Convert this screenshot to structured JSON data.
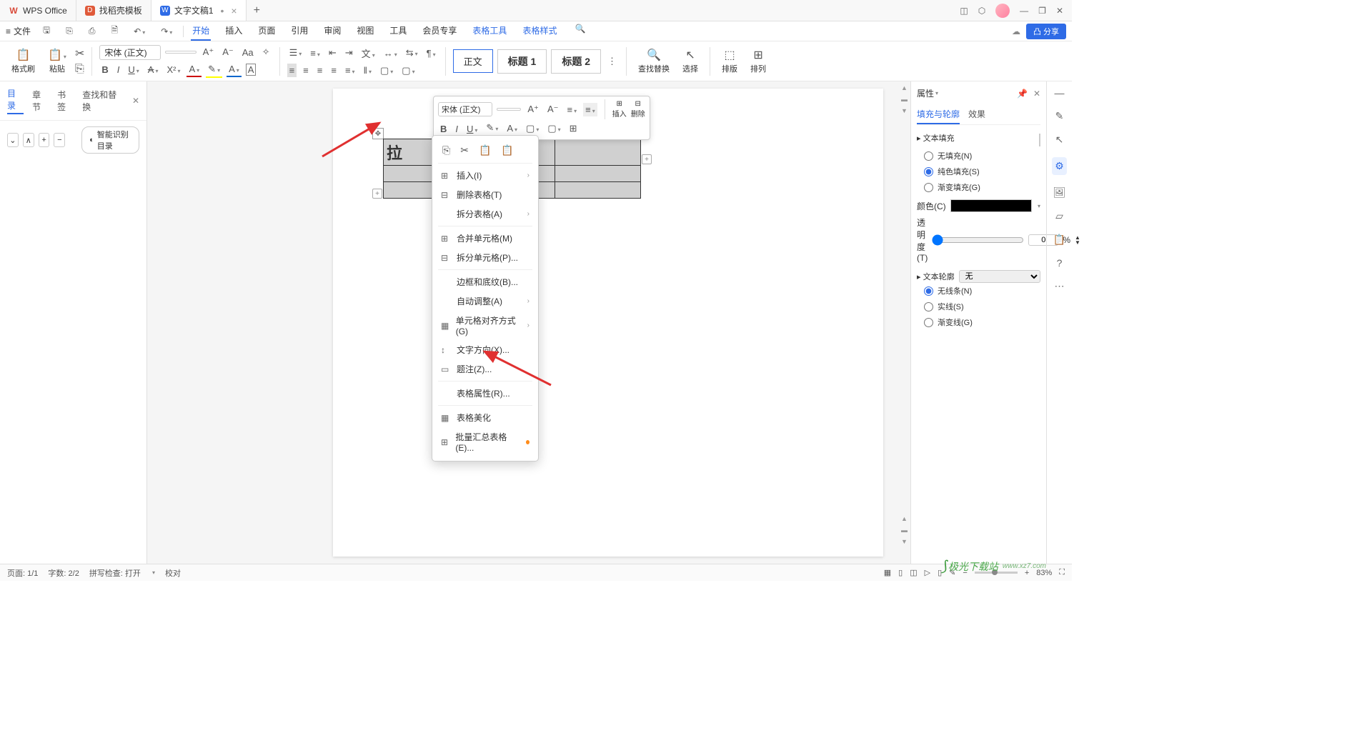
{
  "titlebar": {
    "app": "WPS Office",
    "tab_template": "找稻壳模板",
    "tab_doc": "文字文稿1",
    "min": "—",
    "max": "❐",
    "close": "✕"
  },
  "menubar": {
    "file": "文件",
    "items": [
      "开始",
      "插入",
      "页面",
      "引用",
      "审阅",
      "视图",
      "工具",
      "会员专享",
      "表格工具",
      "表格样式"
    ],
    "active_index": 0,
    "share": "分享"
  },
  "ribbon": {
    "format_painter": "格式刷",
    "paste": "粘贴",
    "font": "宋体 (正文)",
    "find_replace": "查找替换",
    "select": "选择",
    "arrange": "排版",
    "sort": "排列",
    "style_normal": "正文",
    "style_h1": "标题 1",
    "style_h2": "标题 2"
  },
  "leftpanel": {
    "tabs": [
      "目录",
      "章节",
      "书签",
      "查找和替换"
    ],
    "smart": "智能识别目录"
  },
  "float_toolbar": {
    "font": "宋体 (正文)",
    "insert": "插入",
    "delete": "删除"
  },
  "table_cell": "拉",
  "context": {
    "items": [
      {
        "icon": "⊞",
        "label": "插入(I)",
        "arrow": true
      },
      {
        "icon": "⊟",
        "label": "删除表格(T)"
      },
      {
        "icon": "",
        "label": "拆分表格(A)",
        "arrow": true
      },
      {
        "icon": "⊞",
        "label": "合并单元格(M)"
      },
      {
        "icon": "⊟",
        "label": "拆分单元格(P)..."
      },
      {
        "icon": "",
        "label": "边框和底纹(B)..."
      },
      {
        "icon": "",
        "label": "自动调整(A)",
        "arrow": true
      },
      {
        "icon": "▦",
        "label": "单元格对齐方式(G)",
        "arrow": true
      },
      {
        "icon": "↕",
        "label": "文字方向(X)..."
      },
      {
        "icon": "▭",
        "label": "题注(Z)..."
      },
      {
        "icon": "",
        "label": "表格属性(R)..."
      },
      {
        "icon": "▦",
        "label": "表格美化"
      },
      {
        "icon": "⊞",
        "label": "批量汇总表格(E)...",
        "dot": true
      }
    ]
  },
  "rightpanel": {
    "title": "属性",
    "tabs": [
      "填充与轮廓",
      "效果"
    ],
    "text_fill": "文本填充",
    "fill_none": "无填充(N)",
    "fill_solid": "纯色填充(S)",
    "fill_grad": "渐变填充(G)",
    "color": "颜色(C)",
    "opacity": "透明度(T)",
    "opacity_val": "0",
    "pct": "%",
    "text_outline": "文本轮廓",
    "outline_sel": "无",
    "line_none": "无线条(N)",
    "line_solid": "实线(S)",
    "line_grad": "渐变线(G)"
  },
  "statusbar": {
    "page": "页面: 1/1",
    "words": "字数: 2/2",
    "spell": "拼写检查: 打开",
    "proof": "校对",
    "zoom": "83%"
  },
  "watermark": {
    "brand": "极光下载站",
    "url": "www.xz7.com"
  }
}
